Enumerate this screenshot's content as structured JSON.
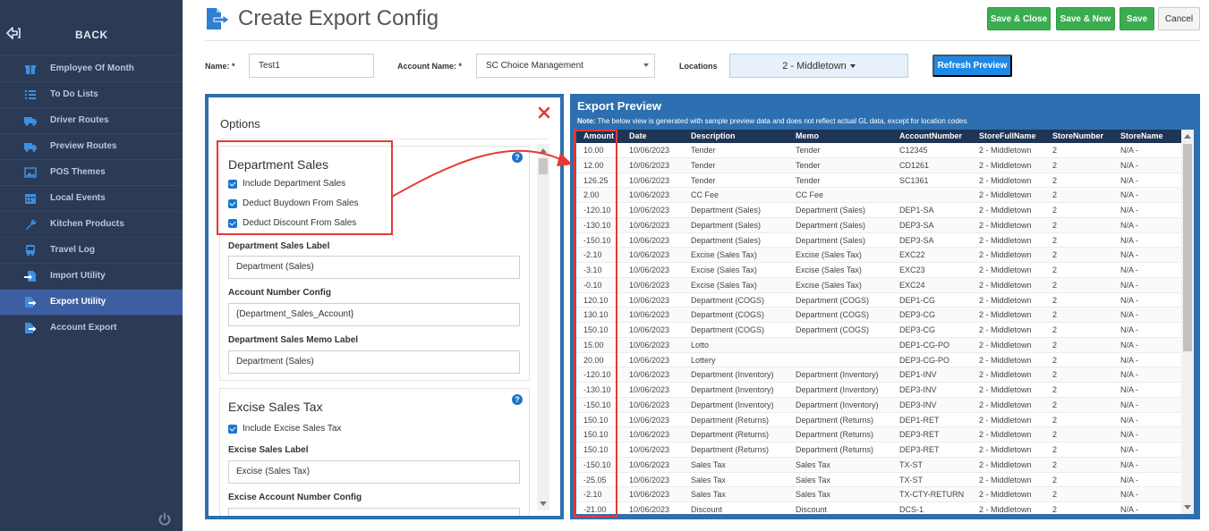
{
  "sidebar": {
    "back_label": "BACK",
    "items": [
      {
        "label": "Employee Of Month",
        "icon": "gift-icon"
      },
      {
        "label": "To Do Lists",
        "icon": "list-icon"
      },
      {
        "label": "Driver Routes",
        "icon": "truck-icon"
      },
      {
        "label": "Preview Routes",
        "icon": "truck-icon"
      },
      {
        "label": "POS Themes",
        "icon": "image-icon"
      },
      {
        "label": "Local Events",
        "icon": "calendar-icon"
      },
      {
        "label": "Kitchen Products",
        "icon": "wrench-icon"
      },
      {
        "label": "Travel Log",
        "icon": "bus-icon"
      },
      {
        "label": "Import Utility",
        "icon": "file-import-icon"
      },
      {
        "label": "Export Utility",
        "icon": "file-export-icon",
        "active": true
      },
      {
        "label": "Account Export",
        "icon": "file-export-icon"
      }
    ]
  },
  "header": {
    "title": "Create Export Config",
    "buttons": {
      "save_close": "Save & Close",
      "save_new": "Save & New",
      "save": "Save",
      "cancel": "Cancel"
    }
  },
  "form": {
    "name_label": "Name: *",
    "name_value": "Test1",
    "account_label": "Account Name: *",
    "account_value": "SC Choice Management",
    "locations_label": "Locations",
    "locations_value": "2 - Middletown",
    "refresh_label": "Refresh Preview"
  },
  "options": {
    "title": "Options",
    "department": {
      "title": "Department Sales",
      "checks": [
        "Include Department Sales",
        "Deduct Buydown From Sales",
        "Deduct Discount From Sales"
      ],
      "sales_label": "Department Sales Label",
      "sales_value": "Department (Sales)",
      "account_label": "Account Number Config",
      "account_value": "{Department_Sales_Account}",
      "memo_label": "Department Sales Memo Label",
      "memo_value": "Department (Sales)"
    },
    "excise": {
      "title": "Excise Sales Tax",
      "check": "Include Excise Sales Tax",
      "label_label": "Excise Sales Label",
      "label_value": "Excise (Sales Tax)",
      "account_label": "Excise Account Number Config"
    }
  },
  "preview": {
    "title": "Export Preview",
    "note_bold": "Note:",
    "note_text": "The below view is generated with sample preview data and does not reflect actual GL data, except for location codes.",
    "columns": [
      "Amount",
      "Date",
      "Description",
      "Memo",
      "AccountNumber",
      "StoreFullName",
      "StoreNumber",
      "StoreName"
    ],
    "rows": [
      [
        "10.00",
        "10/06/2023",
        "Tender",
        "Tender",
        "C12345",
        "2 - Middletown",
        "2",
        "N/A -"
      ],
      [
        "12.00",
        "10/06/2023",
        "Tender",
        "Tender",
        "CD1261",
        "2 - Middletown",
        "2",
        "N/A -"
      ],
      [
        "126.25",
        "10/06/2023",
        "Tender",
        "Tender",
        "SC1361",
        "2 - Middletown",
        "2",
        "N/A -"
      ],
      [
        "2.00",
        "10/06/2023",
        "CC Fee",
        "CC Fee",
        "",
        "2 - Middletown",
        "2",
        "N/A -"
      ],
      [
        "-120.10",
        "10/06/2023",
        "Department (Sales)",
        "Department (Sales)",
        "DEP1-SA",
        "2 - Middletown",
        "2",
        "N/A -"
      ],
      [
        "-130.10",
        "10/06/2023",
        "Department (Sales)",
        "Department (Sales)",
        "DEP3-SA",
        "2 - Middletown",
        "2",
        "N/A -"
      ],
      [
        "-150.10",
        "10/06/2023",
        "Department (Sales)",
        "Department (Sales)",
        "DEP3-SA",
        "2 - Middletown",
        "2",
        "N/A -"
      ],
      [
        "-2.10",
        "10/06/2023",
        "Excise (Sales Tax)",
        "Excise (Sales Tax)",
        "EXC22",
        "2 - Middletown",
        "2",
        "N/A -"
      ],
      [
        "-3.10",
        "10/06/2023",
        "Excise (Sales Tax)",
        "Excise (Sales Tax)",
        "EXC23",
        "2 - Middletown",
        "2",
        "N/A -"
      ],
      [
        "-0.10",
        "10/06/2023",
        "Excise (Sales Tax)",
        "Excise (Sales Tax)",
        "EXC24",
        "2 - Middletown",
        "2",
        "N/A -"
      ],
      [
        "120.10",
        "10/06/2023",
        "Department (COGS)",
        "Department (COGS)",
        "DEP1-CG",
        "2 - Middletown",
        "2",
        "N/A -"
      ],
      [
        "130.10",
        "10/06/2023",
        "Department (COGS)",
        "Department (COGS)",
        "DEP3-CG",
        "2 - Middletown",
        "2",
        "N/A -"
      ],
      [
        "150.10",
        "10/06/2023",
        "Department (COGS)",
        "Department (COGS)",
        "DEP3-CG",
        "2 - Middletown",
        "2",
        "N/A -"
      ],
      [
        "15.00",
        "10/06/2023",
        "Lotto",
        "",
        "DEP1-CG-PO",
        "2 - Middletown",
        "2",
        "N/A -"
      ],
      [
        "20.00",
        "10/06/2023",
        "Lottery",
        "",
        "DEP3-CG-PO",
        "2 - Middletown",
        "2",
        "N/A -"
      ],
      [
        "-120.10",
        "10/06/2023",
        "Department (Inventory)",
        "Department (Inventory)",
        "DEP1-INV",
        "2 - Middletown",
        "2",
        "N/A -"
      ],
      [
        "-130.10",
        "10/06/2023",
        "Department (Inventory)",
        "Department (Inventory)",
        "DEP3-INV",
        "2 - Middletown",
        "2",
        "N/A -"
      ],
      [
        "-150.10",
        "10/06/2023",
        "Department (Inventory)",
        "Department (Inventory)",
        "DEP3-INV",
        "2 - Middletown",
        "2",
        "N/A -"
      ],
      [
        "150.10",
        "10/06/2023",
        "Department (Returns)",
        "Department (Returns)",
        "DEP1-RET",
        "2 - Middletown",
        "2",
        "N/A -"
      ],
      [
        "150.10",
        "10/06/2023",
        "Department (Returns)",
        "Department (Returns)",
        "DEP3-RET",
        "2 - Middletown",
        "2",
        "N/A -"
      ],
      [
        "150.10",
        "10/06/2023",
        "Department (Returns)",
        "Department (Returns)",
        "DEP3-RET",
        "2 - Middletown",
        "2",
        "N/A -"
      ],
      [
        "-150.10",
        "10/06/2023",
        "Sales Tax",
        "Sales Tax",
        "TX-ST",
        "2 - Middletown",
        "2",
        "N/A -"
      ],
      [
        "-25.05",
        "10/06/2023",
        "Sales Tax",
        "Sales Tax",
        "TX-ST",
        "2 - Middletown",
        "2",
        "N/A -"
      ],
      [
        "-2.10",
        "10/06/2023",
        "Sales Tax",
        "Sales Tax",
        "TX-CTY-RETURN",
        "2 - Middletown",
        "2",
        "N/A -"
      ],
      [
        "-21.00",
        "10/06/2023",
        "Discount",
        "Discount",
        "DCS-1",
        "2 - Middletown",
        "2",
        "N/A -"
      ]
    ]
  },
  "colors": {
    "sidebar_bg": "#2b3a55",
    "sidebar_active": "#3d5ea1",
    "panel_blue": "#2d6fb0",
    "save_green": "#3aad4e",
    "refresh_blue": "#1e88e5",
    "highlight_red": "#e53935"
  }
}
